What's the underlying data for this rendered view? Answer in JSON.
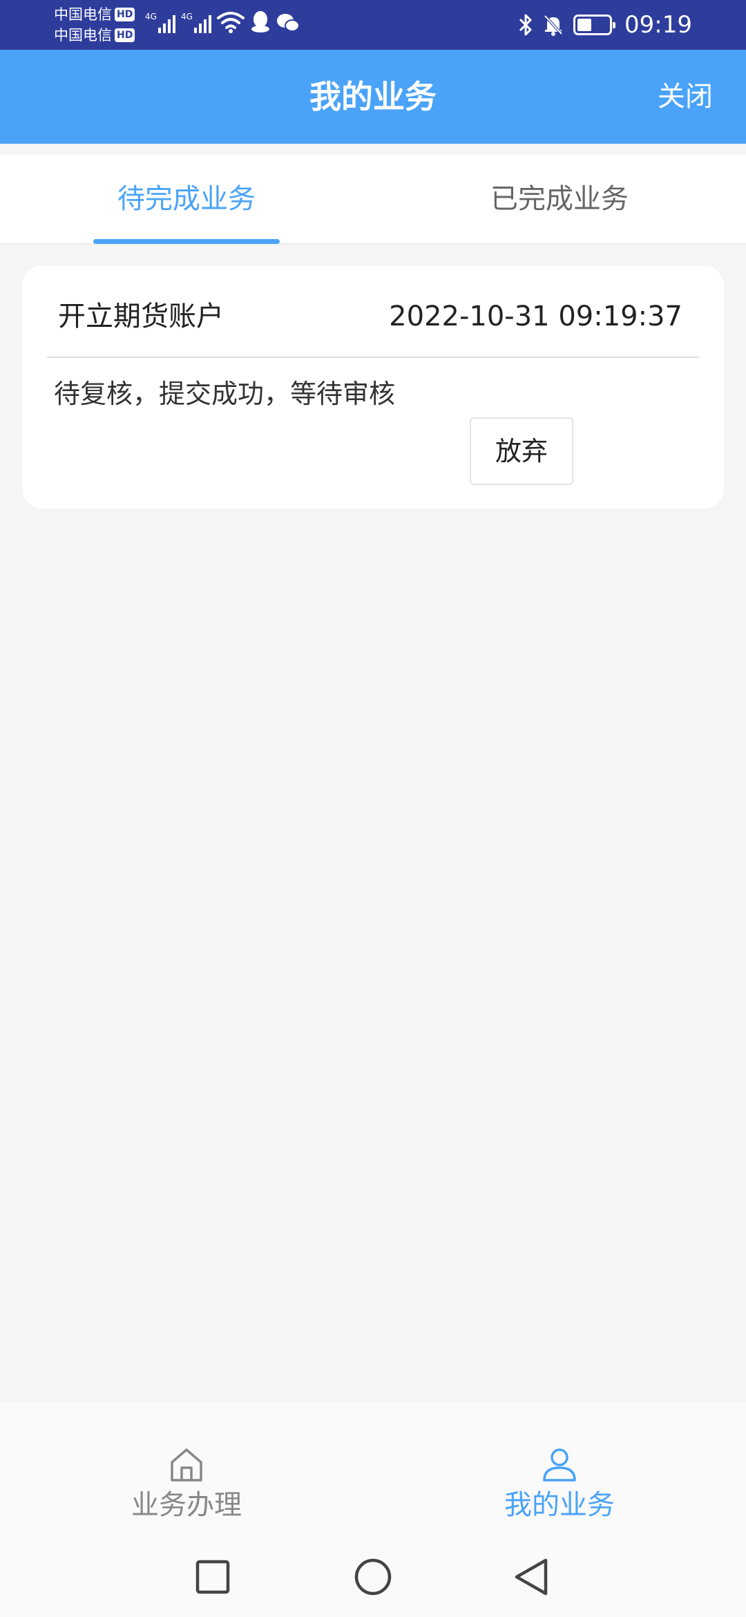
{
  "status_bar": {
    "carrier_1": "中国电信",
    "carrier_2": "中国电信",
    "hd_badge": "HD",
    "network_1": "4G",
    "network_2": "4G",
    "time": "09:19",
    "battery_level": 0.45
  },
  "header": {
    "title": "我的业务",
    "close_label": "关闭",
    "color": "#4aa3f8"
  },
  "tabs": [
    {
      "label": "待完成业务",
      "active": true
    },
    {
      "label": "已完成业务",
      "active": false
    }
  ],
  "business_card": {
    "title": "开立期货账户",
    "time": "2022-10-31 09:19:37",
    "status": "待复核，提交成功，等待审核",
    "abandon_label": "放弃"
  },
  "bottom_tabs": [
    {
      "label": "业务办理",
      "icon": "home-icon",
      "active": false
    },
    {
      "label": "我的业务",
      "icon": "user-icon",
      "active": true
    }
  ],
  "system_nav": [
    "recent-apps-icon",
    "home-circle-icon",
    "back-icon"
  ],
  "colors": {
    "status_bar": "#2e3d9c",
    "accent": "#4aa3f8",
    "background": "#f5f5f5"
  }
}
